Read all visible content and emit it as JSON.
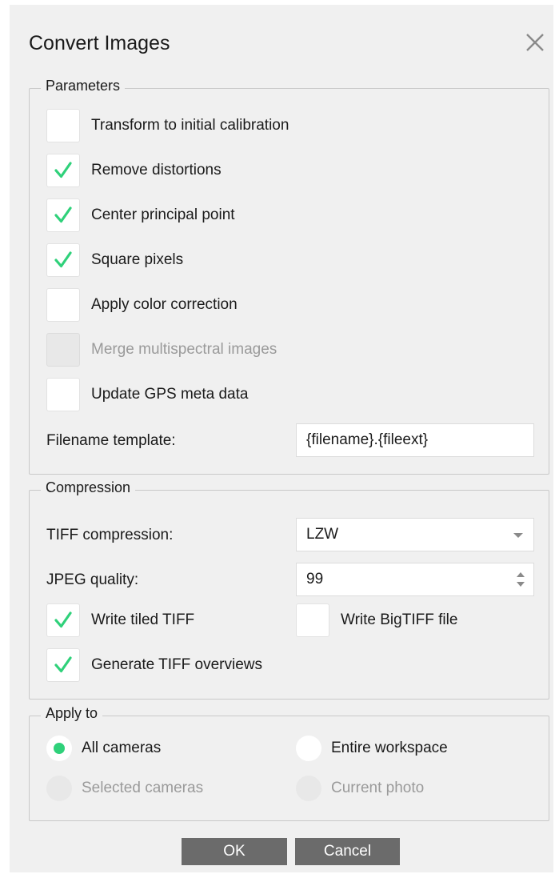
{
  "dialog": {
    "title": "Convert Images",
    "close_icon": "close-icon"
  },
  "parameters": {
    "group_title": "Parameters",
    "options": [
      {
        "label": "Transform to initial calibration",
        "checked": false,
        "enabled": true
      },
      {
        "label": "Remove distortions",
        "checked": true,
        "enabled": true
      },
      {
        "label": "Center principal point",
        "checked": true,
        "enabled": true
      },
      {
        "label": "Square pixels",
        "checked": true,
        "enabled": true
      },
      {
        "label": "Apply color correction",
        "checked": false,
        "enabled": true
      },
      {
        "label": "Merge multispectral images",
        "checked": false,
        "enabled": false
      },
      {
        "label": "Update GPS meta data",
        "checked": false,
        "enabled": true
      }
    ],
    "filename_template_label": "Filename template:",
    "filename_template_value": "{filename}.{fileext}"
  },
  "compression": {
    "group_title": "Compression",
    "tiff_compression_label": "TIFF compression:",
    "tiff_compression_value": "LZW",
    "jpeg_quality_label": "JPEG quality:",
    "jpeg_quality_value": "99",
    "write_tiled_tiff": {
      "label": "Write tiled TIFF",
      "checked": true
    },
    "write_bigtiff": {
      "label": "Write BigTIFF file",
      "checked": false
    },
    "generate_overviews": {
      "label": "Generate TIFF overviews",
      "checked": true
    }
  },
  "apply_to": {
    "group_title": "Apply to",
    "options": [
      {
        "label": "All cameras",
        "selected": true,
        "enabled": true
      },
      {
        "label": "Entire workspace",
        "selected": false,
        "enabled": true
      },
      {
        "label": "Selected cameras",
        "selected": false,
        "enabled": false
      },
      {
        "label": "Current photo",
        "selected": false,
        "enabled": false
      }
    ]
  },
  "buttons": {
    "ok_label": "OK",
    "cancel_label": "Cancel"
  },
  "colors": {
    "check_green": "#2fd17a",
    "dialog_bg": "#f0f0f0",
    "button_bg": "#6b6b6b"
  }
}
